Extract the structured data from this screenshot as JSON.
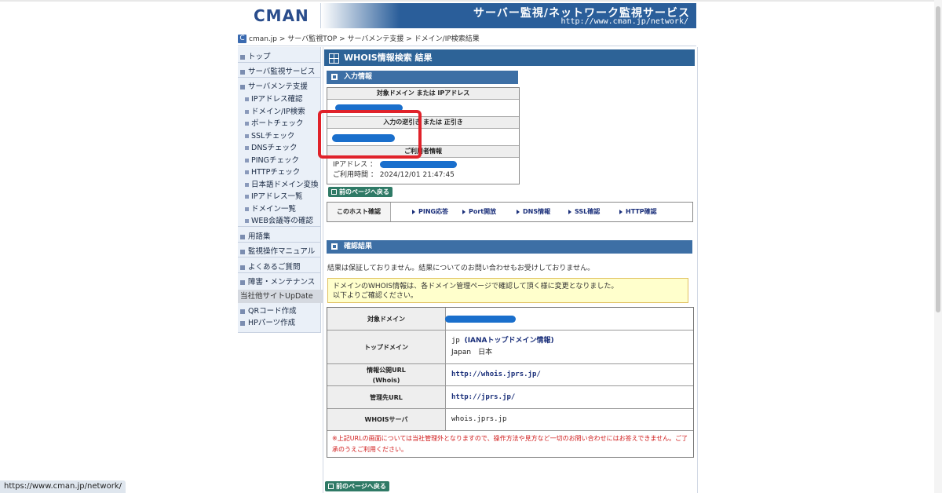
{
  "header": {
    "logo": "CMAN",
    "title": "サーバー監視/ネットワーク監視サービス",
    "url": "http://www.cman.jp/network/"
  },
  "breadcrumb": {
    "icon": "C",
    "items": [
      "cman.jp",
      "サーバ監視TOP",
      "サーバメンテ支援",
      "ドメイン/IP検索結果"
    ],
    "separator": " > "
  },
  "sidebar": {
    "items": [
      {
        "label": "トップ"
      },
      {
        "label": "サーバ監視サービス"
      },
      {
        "label": "サーバメンテ支援"
      },
      {
        "label": "IPアドレス確認"
      },
      {
        "label": "ドメイン/IP検索"
      },
      {
        "label": "ポートチェック"
      },
      {
        "label": "SSLチェック"
      },
      {
        "label": "DNSチェック"
      },
      {
        "label": "PINGチェック"
      },
      {
        "label": "HTTPチェック"
      },
      {
        "label": "日本語ドメイン変換"
      },
      {
        "label": "IPアドレス一覧"
      },
      {
        "label": "ドメイン一覧"
      },
      {
        "label": "WEB会議等の確認"
      },
      {
        "label": "用語集"
      },
      {
        "label": "監視操作マニュアル"
      },
      {
        "label": "よくあるご質問"
      },
      {
        "label": "障害・メンテナンス"
      }
    ],
    "section": "当社他サイトUpDate",
    "section_items": [
      {
        "label": "QRコード作成"
      },
      {
        "label": "HPパーツ作成"
      }
    ]
  },
  "main": {
    "title": "WHOIS情報検索 結果",
    "input_section": {
      "heading": "入力情報",
      "target_label": "対象ドメイン または IPアドレス",
      "lookup_label": "入力の逆引き または 正引き",
      "user_label": "ご利用者情報",
      "ip_label": "IPアドレス ：",
      "time_label": "ご利用時間 ：",
      "time_value": "2024/12/01 21:47:45"
    },
    "back_button": "前のページへ戻る",
    "host_check": {
      "label": "このホスト確認",
      "links": [
        "PING応答",
        "Port開放",
        "DNS情報",
        "SSL確認",
        "HTTP確認"
      ]
    },
    "result_section": {
      "heading": "確認結果",
      "disclaimer": "結果は保証しておりません。結果についてのお問い合わせもお受けしておりません。",
      "notice_line1": "ドメインのWHOIS情報は、各ドメイン管理ページで確認して頂く様に変更となりました。",
      "notice_line2": "以下よりご確認ください。"
    },
    "result_table": {
      "rows": [
        {
          "label": "対象ドメイン",
          "value": ""
        },
        {
          "label": "トップドメイン",
          "value_line1": "jp",
          "value_link": "(IANAトップドメイン情報)",
          "value_line2": "Japan　日本"
        },
        {
          "label_line1": "情報公開URL",
          "label_line2": "(Whois)",
          "value": "http://whois.jprs.jp/"
        },
        {
          "label": "管理先URL",
          "value": "http://jprs.jp/"
        },
        {
          "label": "WHOISサーバ",
          "value": "whois.jprs.jp"
        }
      ],
      "note": "※上記URLの画面については当社管理外となりますので、操作方法や見方など一切のお問い合わせにはお答えできません。ご了承のうえご利用ください。"
    }
  },
  "status_bar": {
    "url": "https://www.cman.jp/network/"
  },
  "colors": {
    "header_blue": "#2a5e9a",
    "section_blue": "#3d6fa5",
    "button_green": "#2f7a66",
    "redaction_blue": "#1a6fcc",
    "highlight_red": "#e0222a",
    "notice_yellow": "#ffffcc"
  }
}
